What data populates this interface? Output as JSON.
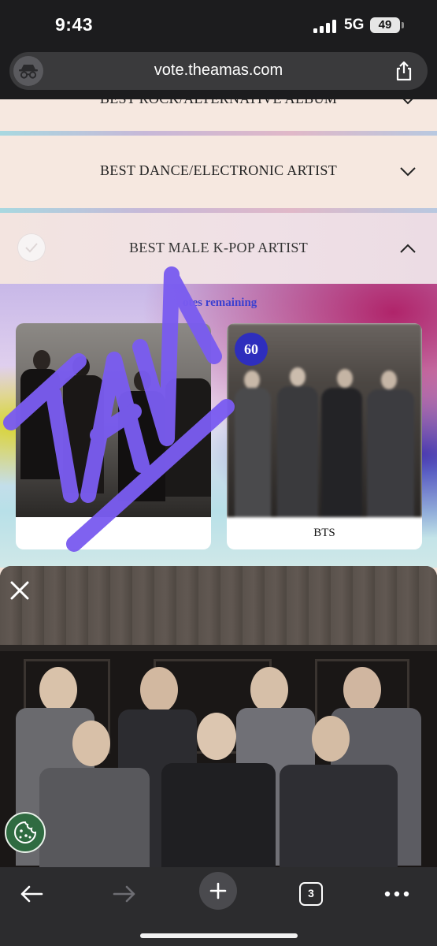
{
  "status_bar": {
    "time": "9:43",
    "network": "5G",
    "battery": "49"
  },
  "browser": {
    "url": "vote.theamas.com",
    "tab_count": "3"
  },
  "categories": {
    "prev_partial": "BEST ROCK/ALTERNATIVE ALBUM",
    "dance": "BEST DANCE/ELECTRONIC ARTIST",
    "kpop": "BEST MALE K-POP ARTIST"
  },
  "voting": {
    "votes_remaining_text": "otes remaining",
    "nominees": [
      {
        "name": "",
        "votes": ""
      },
      {
        "name": "BTS",
        "votes": "60"
      }
    ]
  },
  "overlay": {
    "scribble_text": "TAN"
  },
  "colors": {
    "accent": "#2e2ebd",
    "scribble": "#7a5cf0",
    "cookie": "#2f6b41"
  },
  "icons": [
    "incognito-icon",
    "share-icon",
    "chevron-down-icon",
    "chevron-up-icon",
    "check-icon",
    "close-icon",
    "cookie-icon",
    "back-icon",
    "forward-icon",
    "plus-icon",
    "more-icon"
  ]
}
